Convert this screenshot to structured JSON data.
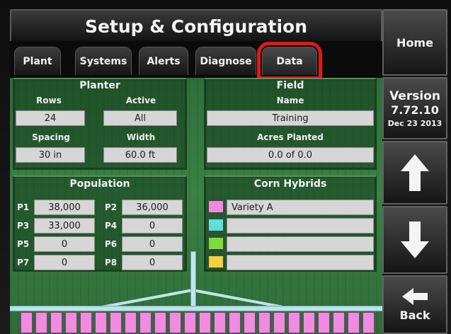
{
  "header": {
    "title": "Setup & Configuration"
  },
  "tabs": [
    {
      "label": "Plant"
    },
    {
      "label": "Systems"
    },
    {
      "label": "Alerts"
    },
    {
      "label": "Diagnose"
    },
    {
      "label": "Data"
    }
  ],
  "active_tab": "Data",
  "planter": {
    "title": "Planter",
    "rows_label": "Rows",
    "rows_value": "24",
    "active_label": "Active",
    "active_value": "All",
    "spacing_label": "Spacing",
    "spacing_value": "30 in",
    "width_label": "Width",
    "width_value": "60.0 ft"
  },
  "field": {
    "title": "Field",
    "name_label": "Name",
    "name_value": "Training",
    "acres_label": "Acres Planted",
    "acres_value": "0.0  of  0.0"
  },
  "population": {
    "title": "Population",
    "items": [
      {
        "label": "P1",
        "value": "38,000"
      },
      {
        "label": "P2",
        "value": "36,000"
      },
      {
        "label": "P3",
        "value": "33,000"
      },
      {
        "label": "P4",
        "value": "0"
      },
      {
        "label": "P5",
        "value": "0"
      },
      {
        "label": "P6",
        "value": "0"
      },
      {
        "label": "P7",
        "value": "0"
      },
      {
        "label": "P8",
        "value": "0"
      }
    ]
  },
  "hybrids": {
    "title": "Corn Hybrids",
    "items": [
      {
        "color": "#f08be0",
        "name": "Variety A"
      },
      {
        "color": "#5ee0dc",
        "name": ""
      },
      {
        "color": "#7ddc3a",
        "name": ""
      },
      {
        "color": "#f2d23c",
        "name": ""
      }
    ]
  },
  "planter_rows": 24,
  "sidebar": {
    "home": "Home",
    "version_label": "Version",
    "version_number": "7.72.10",
    "version_date": "Dec 23 2013",
    "up_icon": "arrow-up-icon",
    "down_icon": "arrow-down-icon",
    "back_icon": "arrow-left-icon",
    "back_label": "Back"
  },
  "colors": {
    "highlight": "#e21818",
    "field_green": "#3a8245",
    "row_unit": "#f08be0"
  }
}
